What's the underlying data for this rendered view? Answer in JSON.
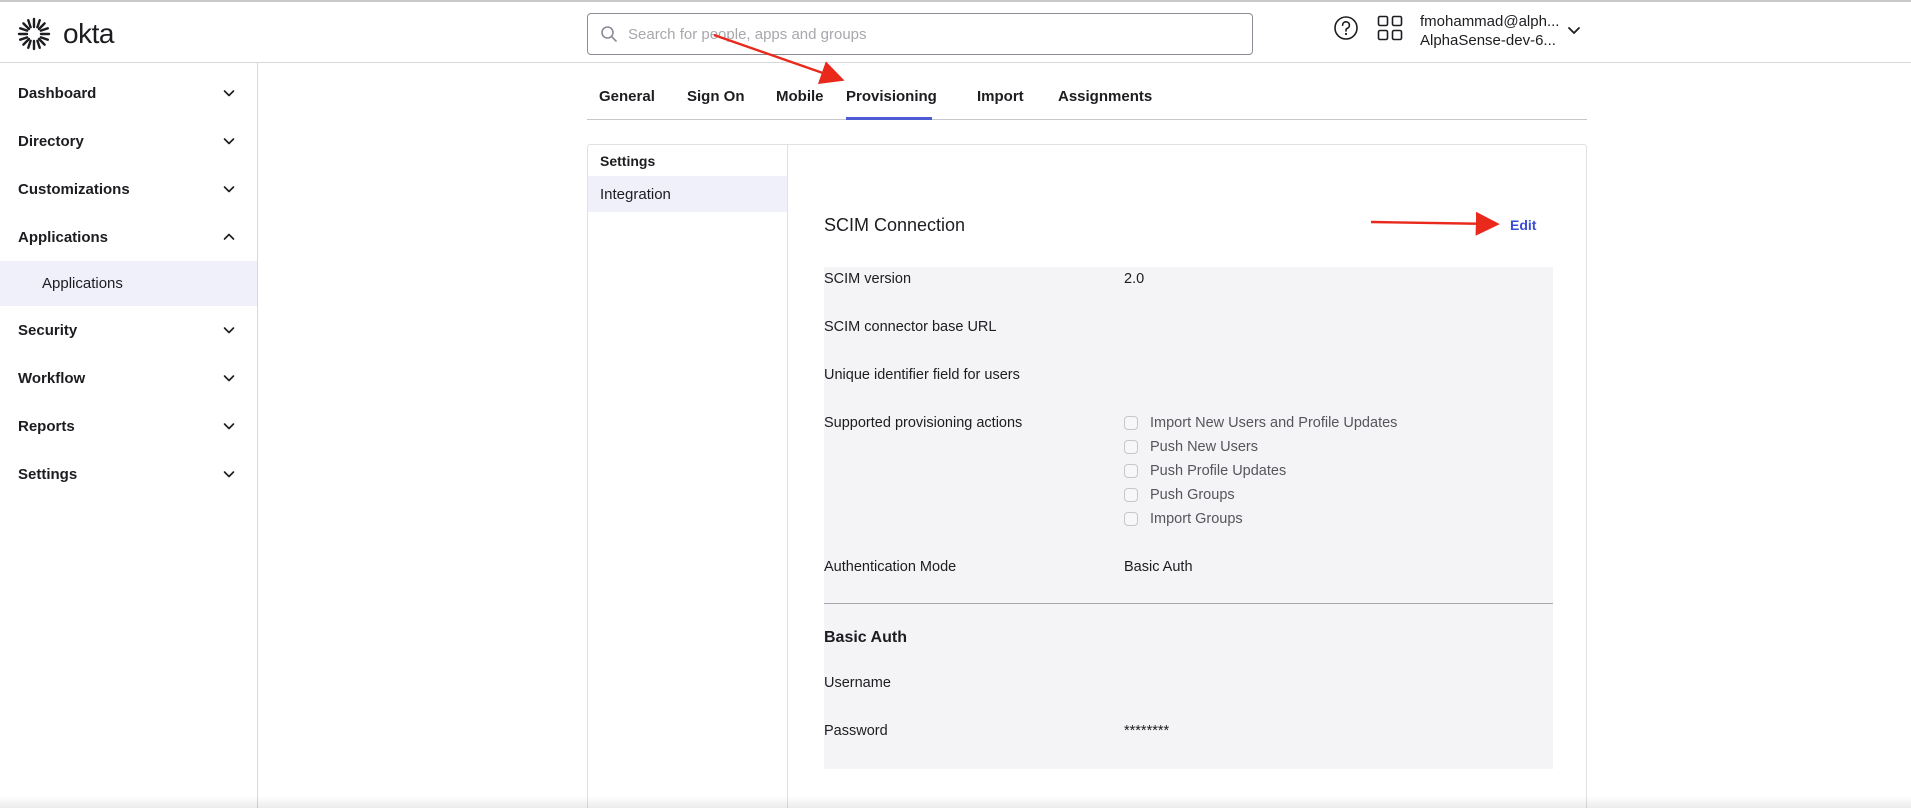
{
  "header": {
    "logo_text": "okta",
    "search_placeholder": "Search for people, apps and groups",
    "user_email": "fmohammad@alph...",
    "user_org": "AlphaSense-dev-6..."
  },
  "sidebar": {
    "items": [
      {
        "label": "Dashboard"
      },
      {
        "label": "Directory"
      },
      {
        "label": "Customizations"
      },
      {
        "label": "Applications"
      },
      {
        "label": "Security"
      },
      {
        "label": "Workflow"
      },
      {
        "label": "Reports"
      },
      {
        "label": "Settings"
      }
    ],
    "sub_item": "Applications"
  },
  "tabs": [
    "General",
    "Sign On",
    "Mobile",
    "Provisioning",
    "Import",
    "Assignments"
  ],
  "active_tab": "Provisioning",
  "settings_nav": {
    "title": "Settings",
    "item": "Integration"
  },
  "scim": {
    "title": "SCIM Connection",
    "edit_label": "Edit",
    "version_label": "SCIM version",
    "version_value": "2.0",
    "base_url_label": "SCIM connector base URL",
    "unique_id_label": "Unique identifier field for users",
    "actions_label": "Supported provisioning actions",
    "actions": [
      "Import New Users and Profile Updates",
      "Push New Users",
      "Push Profile Updates",
      "Push Groups",
      "Import Groups"
    ],
    "auth_mode_label": "Authentication Mode",
    "auth_mode_value": "Basic Auth"
  },
  "basic_auth": {
    "title": "Basic Auth",
    "username_label": "Username",
    "password_label": "Password",
    "password_value": "********"
  },
  "colors": {
    "accent": "#4f5bd5",
    "link": "#3a4dd6",
    "annotation_arrow": "#e8291c",
    "selected_bg": "#eff0f9"
  }
}
